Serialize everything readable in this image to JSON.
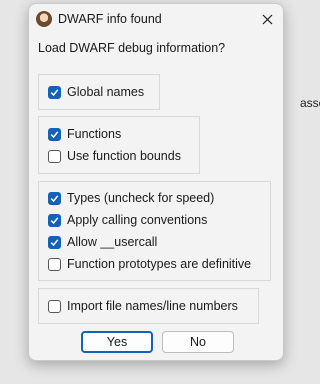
{
  "background": {
    "clipped_text": "asser"
  },
  "dialog": {
    "title": "DWARF info found",
    "prompt": "Load DWARF debug information?"
  },
  "options": [
    {
      "label": "Global names",
      "checked": true
    },
    {
      "label": "Functions",
      "checked": true
    },
    {
      "label": "Use function bounds",
      "checked": false
    },
    {
      "label": "Types (uncheck for speed)",
      "checked": true
    },
    {
      "label": "Apply calling conventions",
      "checked": true
    },
    {
      "label": "Allow __usercall",
      "checked": true
    },
    {
      "label": "Function prototypes are definitive",
      "checked": false
    },
    {
      "label": "Import file names/line numbers",
      "checked": false
    }
  ],
  "buttons": {
    "yes": "Yes",
    "no": "No"
  },
  "colors": {
    "accent": "#1462b8"
  }
}
